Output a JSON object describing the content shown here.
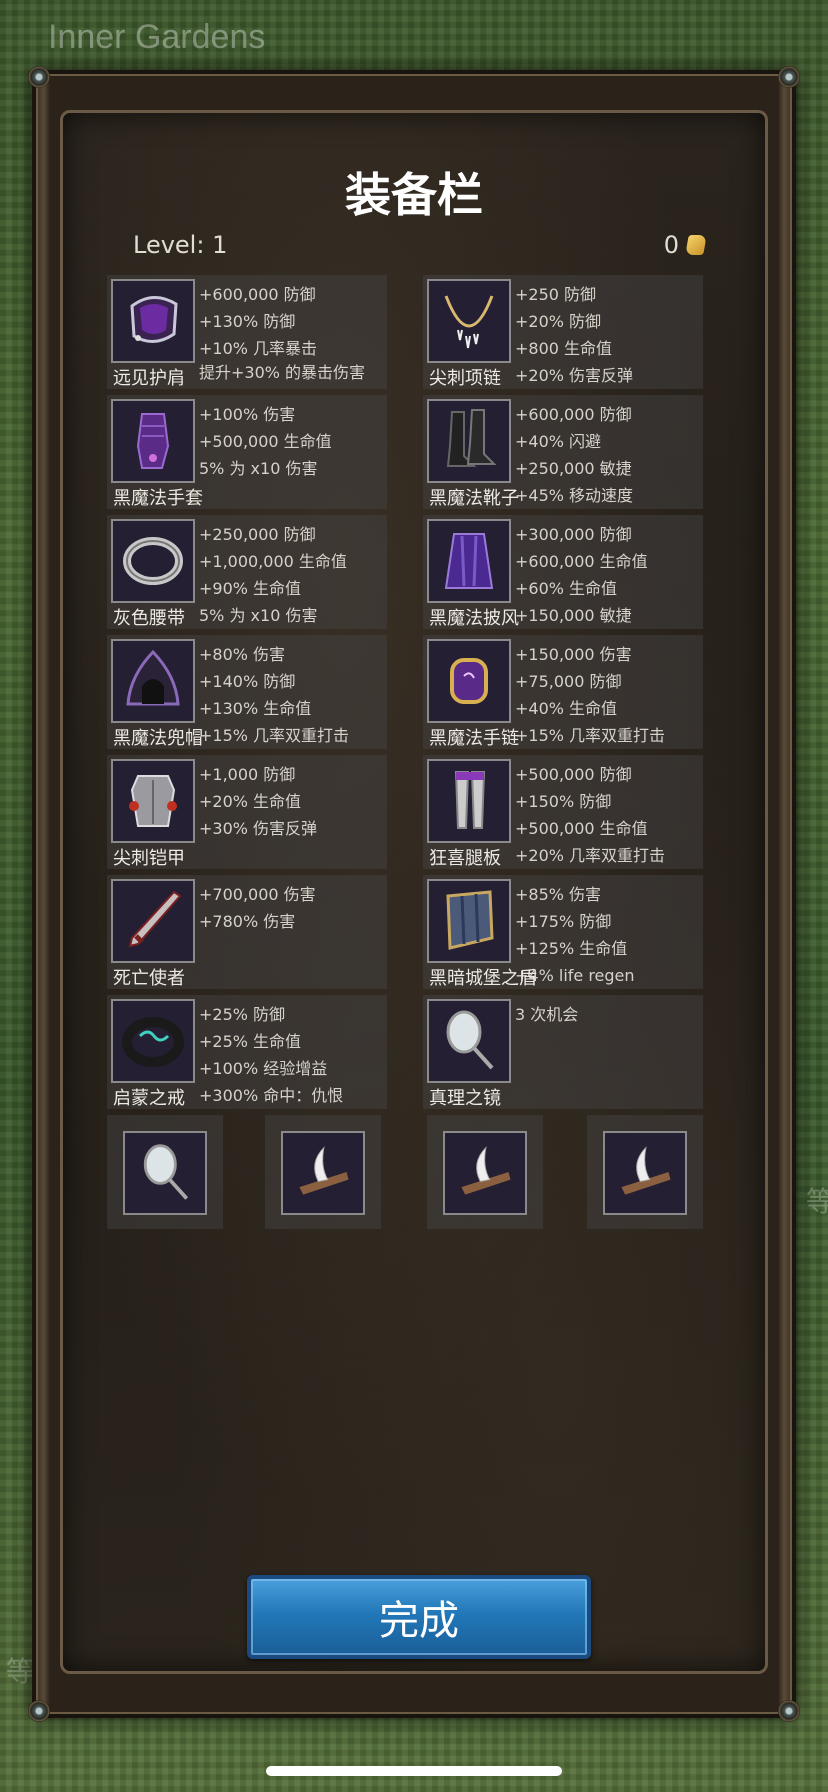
{
  "map_location": "Inner Gardens",
  "background_glyphs": {
    "left": "等",
    "right": "等"
  },
  "panel": {
    "title": "装备栏",
    "level_label": "Level:",
    "level_value": "1",
    "currency_count": "0",
    "currency_icon": "scroll-icon"
  },
  "equipment": [
    {
      "name": "远见护肩",
      "icon": "pauldron-icon",
      "stats": [
        "+600,000 防御",
        "+130% 防御",
        "+10% 几率暴击",
        "提升+30% 的暴击伤害"
      ]
    },
    {
      "name": "尖刺项链",
      "icon": "necklace-icon",
      "stats": [
        "+250 防御",
        "+20% 防御",
        "+800 生命值",
        "+20% 伤害反弹"
      ]
    },
    {
      "name": "黑魔法手套",
      "icon": "gloves-icon",
      "stats": [
        "+100% 伤害",
        "+500,000 生命值",
        "5% 为 x10 伤害"
      ]
    },
    {
      "name": "黑魔法靴子",
      "icon": "boots-icon",
      "stats": [
        "+600,000 防御",
        "+40% 闪避",
        "+250,000 敏捷",
        "+45% 移动速度"
      ]
    },
    {
      "name": "灰色腰带",
      "icon": "belt-icon",
      "stats": [
        "+250,000 防御",
        "+1,000,000 生命值",
        "+90% 生命值",
        "5% 为 x10 伤害"
      ]
    },
    {
      "name": "黑魔法披风",
      "icon": "cape-icon",
      "stats": [
        "+300,000 防御",
        "+600,000 生命值",
        "+60% 生命值",
        "+150,000 敏捷"
      ]
    },
    {
      "name": "黑魔法兜帽",
      "icon": "hood-icon",
      "stats": [
        "+80% 伤害",
        "+140% 防御",
        "+130% 生命值",
        "+15% 几率双重打击"
      ]
    },
    {
      "name": "黑魔法手链",
      "icon": "bracelet-icon",
      "stats": [
        "+150,000 伤害",
        "+75,000 防御",
        "+40% 生命值",
        "+15% 几率双重打击"
      ]
    },
    {
      "name": "尖刺铠甲",
      "icon": "armor-icon",
      "stats": [
        "+1,000 防御",
        "+20% 生命值",
        "+30% 伤害反弹"
      ]
    },
    {
      "name": "狂喜腿板",
      "icon": "greaves-icon",
      "stats": [
        "+500,000 防御",
        "+150% 防御",
        "+500,000 生命值",
        "+20% 几率双重打击"
      ]
    },
    {
      "name": "死亡使者",
      "icon": "sword-icon",
      "stats": [
        "+700,000 伤害",
        "+780% 伤害"
      ]
    },
    {
      "name": "黑暗城堡之盾",
      "icon": "shield-icon",
      "stats": [
        "+85% 伤害",
        "+175% 防御",
        "+125% 生命值",
        "+4% life regen"
      ]
    },
    {
      "name": "启蒙之戒",
      "icon": "ring-icon",
      "stats": [
        "+25% 防御",
        "+25% 生命值",
        "+100% 经验增益",
        "+300% 命中：仇恨"
      ]
    },
    {
      "name": "真理之镜",
      "icon": "mirror-icon",
      "stats": [
        "3 次机会"
      ]
    }
  ],
  "inventory": [
    {
      "icon": "mirror-icon"
    },
    {
      "icon": "claw-icon"
    },
    {
      "icon": "claw-icon"
    },
    {
      "icon": "claw-icon"
    }
  ],
  "done_button": {
    "label": "完成"
  }
}
